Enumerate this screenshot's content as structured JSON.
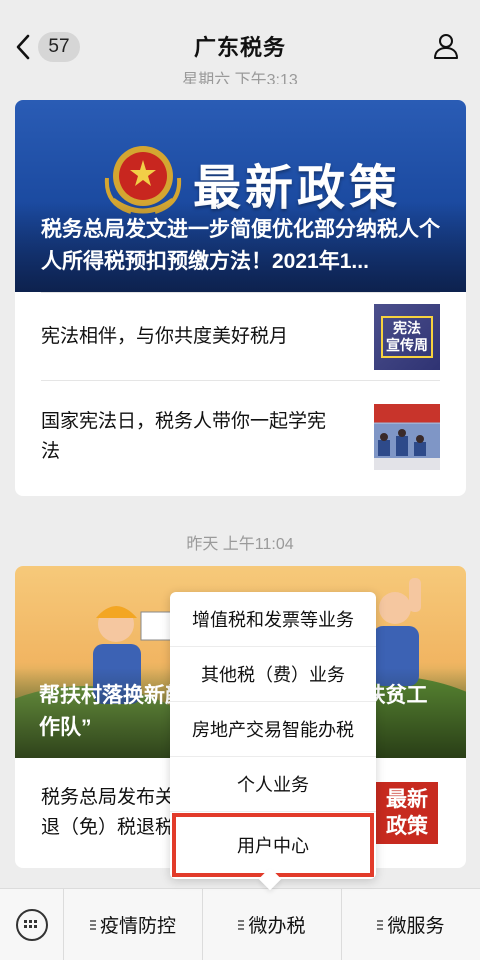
{
  "header": {
    "back_badge": "57",
    "title": "广东税务"
  },
  "timestamps": {
    "first": "星期六 下午3:13",
    "second": "昨天 上午11:04"
  },
  "card1": {
    "banner_text": "最新政策",
    "cover_title": "税务总局发文进一步简便优化部分纳税人个人所得税预扣预缴方法！2021年1...",
    "items": [
      {
        "title": "宪法相伴，与你共度美好税月",
        "thumb_text": "宪法\n宣传周"
      },
      {
        "title": "国家宪法日，税务人带你一起学宪法"
      }
    ]
  },
  "card2": {
    "cover_title": "帮扶村落换新颜——记一支“不走的扶贫工作队”",
    "item_title": "税务总局发布关于进一步加强出口退（免）税退税管理办法",
    "thumb_text": "最新\n政策"
  },
  "popup_menu": {
    "items": [
      {
        "label": "增值税和发票等业务"
      },
      {
        "label": "其他税（费）业务"
      },
      {
        "label": "房地产交易智能办税"
      },
      {
        "label": "个人业务"
      },
      {
        "label": "用户中心"
      }
    ],
    "highlight_color": "#e23b2a"
  },
  "bottom_menu": {
    "tabs": [
      {
        "label": "疫情防控"
      },
      {
        "label": "微办税"
      },
      {
        "label": "微服务"
      }
    ]
  },
  "icons": {
    "back": "chevron-left-icon",
    "profile": "user-icon",
    "keyboard": "keyboard-icon"
  }
}
